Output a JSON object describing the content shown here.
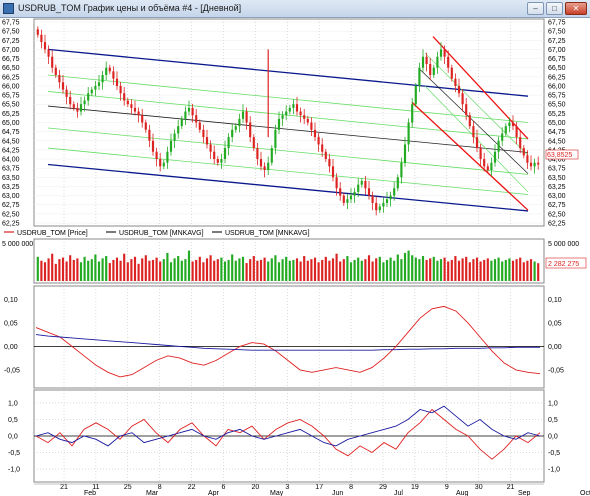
{
  "window": {
    "title": "USDRUB_TOM График цены и объёма #4 - [Дневной]",
    "min_glyph": "–",
    "max_glyph": "□",
    "close_glyph": "✕"
  },
  "colors": {
    "up": "#22aa22",
    "down": "#dd2222",
    "channel_blue": "#0a1a8c",
    "green_line": "#66dd66",
    "red_channel": "#ee1111",
    "mnkavg_black": "#222222",
    "osc_red": "#e02020",
    "osc_blue": "#1a1aa0",
    "grid": "#b8b8b8"
  },
  "legend": {
    "price": "USDRUB_TOM [Price]",
    "mnk1": "USDRUB_TOM [MNKAVG]",
    "mnk2": "USDRUB_TOM [MNKAVG]"
  },
  "price_axis": {
    "ticks": [
      "67,75",
      "67,50",
      "67,25",
      "67,00",
      "66,75",
      "66,50",
      "66,25",
      "66,00",
      "65,75",
      "65,50",
      "65,25",
      "65,00",
      "64,75",
      "64,50",
      "64,25",
      "64,00",
      "63,75",
      "63,50",
      "63,25",
      "63,00",
      "62,75",
      "62,50",
      "62,25"
    ],
    "last_price": "63,8525"
  },
  "volume_axis": {
    "top_label": "5 000 000",
    "last_value": "2 282 275"
  },
  "osc1_axis": {
    "ticks": [
      "0,10",
      "0,05",
      "0,00",
      "-0,05"
    ]
  },
  "osc2_axis": {
    "ticks": [
      "1,0",
      "0,5",
      "0,0",
      "-0,5",
      "-1,0"
    ]
  },
  "x_axis": {
    "ticks": [
      "21",
      "11",
      "25",
      "8",
      "22",
      "6",
      "20",
      "3",
      "17",
      "8",
      "29",
      "19",
      "9",
      "30",
      "21"
    ],
    "months": [
      "Feb",
      "Mar",
      "Apr",
      "May",
      "Jun",
      "Jul",
      "Aug",
      "Sep",
      "Oct"
    ]
  },
  "chart_data": [
    {
      "type": "candlestick",
      "title": "USDRUB_TOM График цены и объёма #4",
      "series_name": "USDRUB_TOM [Price]",
      "ylim": [
        62.25,
        67.75
      ],
      "last": 63.8525,
      "close": [
        67.4,
        67.2,
        67.0,
        66.8,
        66.5,
        66.3,
        66.1,
        65.9,
        65.7,
        65.5,
        65.4,
        65.3,
        65.5,
        65.6,
        65.8,
        65.9,
        66.0,
        66.1,
        66.3,
        66.5,
        66.4,
        66.2,
        66.0,
        65.8,
        65.6,
        65.5,
        65.4,
        65.3,
        65.2,
        65.0,
        64.8,
        64.5,
        64.2,
        64.0,
        63.8,
        63.9,
        64.2,
        64.5,
        64.7,
        64.9,
        65.1,
        65.3,
        65.4,
        65.2,
        65.0,
        64.8,
        64.6,
        64.4,
        64.2,
        64.0,
        63.9,
        64.0,
        64.3,
        64.6,
        64.8,
        64.9,
        65.1,
        65.3,
        65.0,
        64.6,
        64.3,
        64.0,
        63.8,
        63.7,
        63.9,
        64.3,
        64.8,
        65.1,
        65.2,
        65.3,
        65.4,
        65.5,
        65.3,
        65.2,
        65.1,
        65.0,
        64.8,
        64.6,
        64.4,
        64.2,
        64.0,
        63.8,
        63.5,
        63.2,
        63.0,
        62.8,
        62.9,
        63.0,
        63.1,
        63.3,
        63.4,
        63.2,
        63.0,
        62.8,
        62.6,
        62.7,
        62.8,
        62.9,
        63.0,
        63.2,
        63.5,
        63.9,
        64.4,
        65.0,
        65.5,
        66.0,
        66.5,
        66.8,
        66.6,
        66.3,
        66.5,
        66.8,
        67.0,
        66.8,
        66.5,
        66.2,
        66.0,
        65.8,
        65.5,
        65.2,
        64.9,
        64.6,
        64.3,
        64.0,
        63.8,
        63.7,
        63.9,
        64.2,
        64.5,
        64.7,
        64.9,
        65.0,
        64.9,
        64.6,
        64.3,
        64.1,
        63.9,
        63.8,
        63.9,
        63.85
      ],
      "volume": [
        3.1,
        2.6,
        2.4,
        2.9,
        3.5,
        2.2,
        2.8,
        3.0,
        2.5,
        3.3,
        2.7,
        2.9,
        2.4,
        3.1,
        2.6,
        2.8,
        3.4,
        2.5,
        2.9,
        3.2,
        2.3,
        2.7,
        3.0,
        2.6,
        3.5,
        2.4,
        2.8,
        3.1,
        2.2,
        2.9,
        3.3,
        2.6,
        2.7,
        3.0,
        2.5,
        2.8,
        3.6,
        2.4,
        2.9,
        3.2,
        2.6,
        2.8,
        3.9,
        2.5,
        2.7,
        3.1,
        2.4,
        2.9,
        3.3,
        2.6,
        2.8,
        3.0,
        2.5,
        2.7,
        3.4,
        2.6,
        2.9,
        3.1,
        2.3,
        2.8,
        3.2,
        2.6,
        2.7,
        3.0,
        2.5,
        2.9,
        3.3,
        2.4,
        2.8,
        3.1,
        2.6,
        2.7,
        2.9,
        2.5,
        3.2,
        2.6,
        2.8,
        3.0,
        2.4,
        2.7,
        3.1,
        2.6,
        2.9,
        3.5,
        2.5,
        2.8,
        3.2,
        2.4,
        2.7,
        3.0,
        2.6,
        2.8,
        3.3,
        2.5,
        2.9,
        3.1,
        2.4,
        2.7,
        3.0,
        2.6,
        3.4,
        2.8,
        3.6,
        3.9,
        3.3,
        3.0,
        2.8,
        3.2,
        2.7,
        2.9,
        3.1,
        2.6,
        2.8,
        3.0,
        2.5,
        2.7,
        3.2,
        2.6,
        2.9,
        3.1,
        2.4,
        2.8,
        3.0,
        2.5,
        2.7,
        2.9,
        2.6,
        2.8,
        3.0,
        2.5,
        2.7,
        2.9,
        2.6,
        2.8,
        3.0,
        2.4,
        2.6,
        2.8,
        2.5,
        2.28
      ],
      "volume_unit": "million",
      "osc1": {
        "ylim": [
          -0.08,
          0.12
        ],
        "red": [
          0.04,
          0.03,
          0.02,
          0.0,
          -0.02,
          -0.04,
          -0.055,
          -0.065,
          -0.06,
          -0.045,
          -0.03,
          -0.02,
          -0.025,
          -0.035,
          -0.04,
          -0.03,
          -0.015,
          0.0,
          0.008,
          0.005,
          -0.01,
          -0.03,
          -0.05,
          -0.055,
          -0.05,
          -0.045,
          -0.05,
          -0.055,
          -0.045,
          -0.025,
          0.0,
          0.03,
          0.06,
          0.08,
          0.085,
          0.075,
          0.05,
          0.02,
          -0.01,
          -0.035,
          -0.05,
          -0.055,
          -0.058
        ],
        "blue": [
          0.025,
          0.022,
          0.02,
          0.018,
          0.016,
          0.014,
          0.012,
          0.01,
          0.008,
          0.006,
          0.004,
          0.002,
          0.0,
          -0.002,
          -0.004,
          -0.005,
          -0.006,
          -0.007,
          -0.008,
          -0.008,
          -0.008,
          -0.008,
          -0.008,
          -0.008,
          -0.008,
          -0.008,
          -0.008,
          -0.008,
          -0.008,
          -0.007,
          -0.007,
          -0.006,
          -0.006,
          -0.005,
          -0.005,
          -0.004,
          -0.004,
          -0.004,
          -0.003,
          -0.003,
          -0.002,
          -0.002,
          -0.002
        ]
      },
      "osc2": {
        "ylim": [
          -1.3,
          1.3
        ],
        "red": [
          0.0,
          -0.2,
          0.1,
          -0.3,
          0.2,
          0.4,
          0.2,
          -0.1,
          0.3,
          0.5,
          0.1,
          -0.2,
          0.2,
          0.4,
          0.0,
          -0.3,
          0.2,
          0.1,
          0.3,
          -0.1,
          0.2,
          0.4,
          0.5,
          0.3,
          0.0,
          -0.4,
          -0.6,
          -0.3,
          -0.5,
          -0.2,
          -0.4,
          0.1,
          0.4,
          0.8,
          0.5,
          0.2,
          0.0,
          -0.4,
          -0.7,
          -0.4,
          0.0,
          -0.2,
          0.1
        ],
        "blue": [
          0.0,
          0.1,
          -0.1,
          -0.2,
          0.0,
          -0.1,
          -0.3,
          0.0,
          0.1,
          -0.2,
          -0.1,
          0.0,
          0.1,
          0.2,
          0.0,
          -0.1,
          0.1,
          0.2,
          0.0,
          -0.1,
          0.0,
          0.1,
          0.2,
          0.0,
          -0.2,
          -0.3,
          -0.1,
          0.0,
          0.1,
          0.2,
          0.3,
          0.5,
          0.8,
          0.7,
          0.9,
          0.6,
          0.3,
          0.5,
          0.2,
          0.0,
          -0.1,
          0.1,
          0.0
        ]
      }
    }
  ]
}
